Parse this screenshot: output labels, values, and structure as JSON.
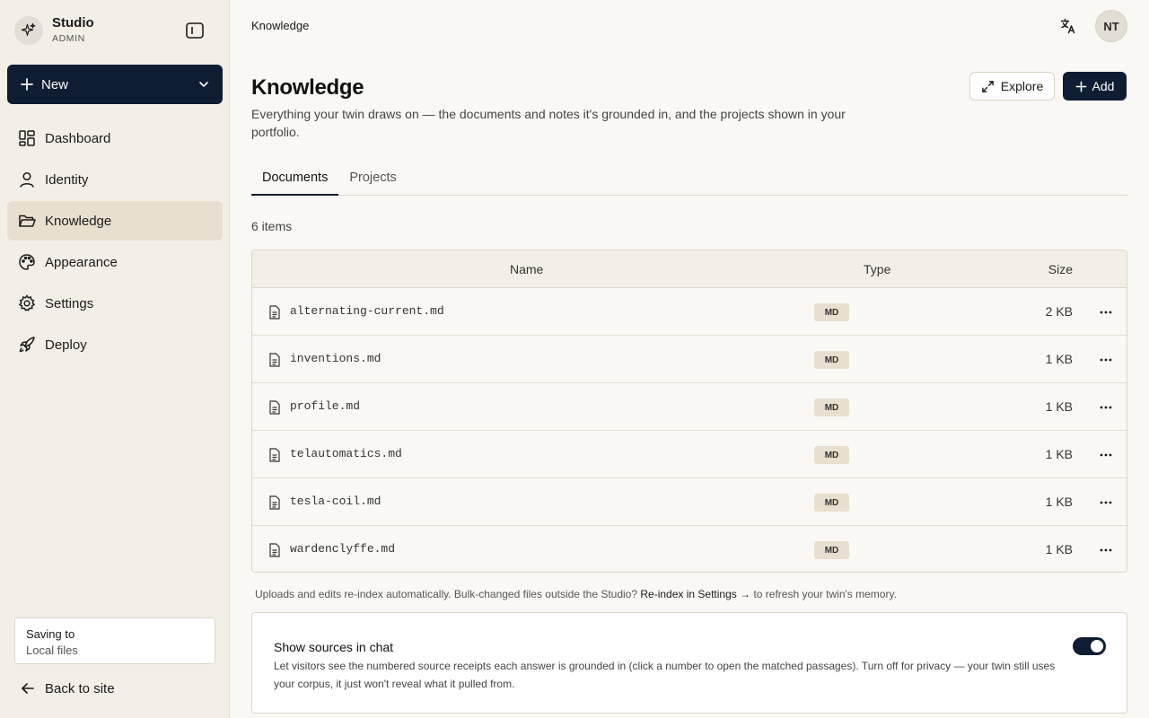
{
  "brand": {
    "name": "Studio",
    "role": "ADMIN"
  },
  "new_button": {
    "label": "New"
  },
  "nav": [
    {
      "label": "Dashboard",
      "icon": "dashboard-icon",
      "active": false
    },
    {
      "label": "Identity",
      "icon": "user-icon",
      "active": false
    },
    {
      "label": "Knowledge",
      "icon": "folder-icon",
      "active": true
    },
    {
      "label": "Appearance",
      "icon": "palette-icon",
      "active": false
    },
    {
      "label": "Settings",
      "icon": "gear-icon",
      "active": false
    },
    {
      "label": "Deploy",
      "icon": "rocket-icon",
      "active": false
    }
  ],
  "saving": {
    "title": "Saving to",
    "value": "Local files"
  },
  "back_link": "Back to site",
  "header": {
    "breadcrumb": "Knowledge",
    "avatar_initials": "NT"
  },
  "page": {
    "title": "Knowledge",
    "description": "Everything your twin draws on — the documents and notes it's grounded in, and the projects shown in your portfolio.",
    "explore_label": "Explore",
    "add_label": "Add"
  },
  "tabs": [
    {
      "label": "Documents",
      "active": true
    },
    {
      "label": "Projects",
      "active": false
    }
  ],
  "item_count": "6 items",
  "table": {
    "columns": {
      "name": "Name",
      "type": "Type",
      "size": "Size"
    },
    "rows": [
      {
        "name": "alternating-current.md",
        "type": "MD",
        "size": "2 KB"
      },
      {
        "name": "inventions.md",
        "type": "MD",
        "size": "1 KB"
      },
      {
        "name": "profile.md",
        "type": "MD",
        "size": "1 KB"
      },
      {
        "name": "telautomatics.md",
        "type": "MD",
        "size": "1 KB"
      },
      {
        "name": "tesla-coil.md",
        "type": "MD",
        "size": "1 KB"
      },
      {
        "name": "wardenclyffe.md",
        "type": "MD",
        "size": "1 KB"
      }
    ]
  },
  "note": {
    "before": "Uploads and edits re-index automatically. Bulk-changed files outside the Studio?",
    "link": "Re-index in Settings →",
    "after": "to refresh your twin's memory."
  },
  "sources_card": {
    "title": "Show sources in chat",
    "description": "Let visitors see the numbered source receipts each answer is grounded in (click a number to open the matched passages). Turn off for privacy — your twin still uses your corpus, it just won't reveal what it pulled from.",
    "enabled": true
  },
  "colors": {
    "primary": "#0f1d33",
    "sidebar_bg": "#f3efe7",
    "active_nav": "#e8dfd0",
    "page_bg": "#faf8f4"
  }
}
